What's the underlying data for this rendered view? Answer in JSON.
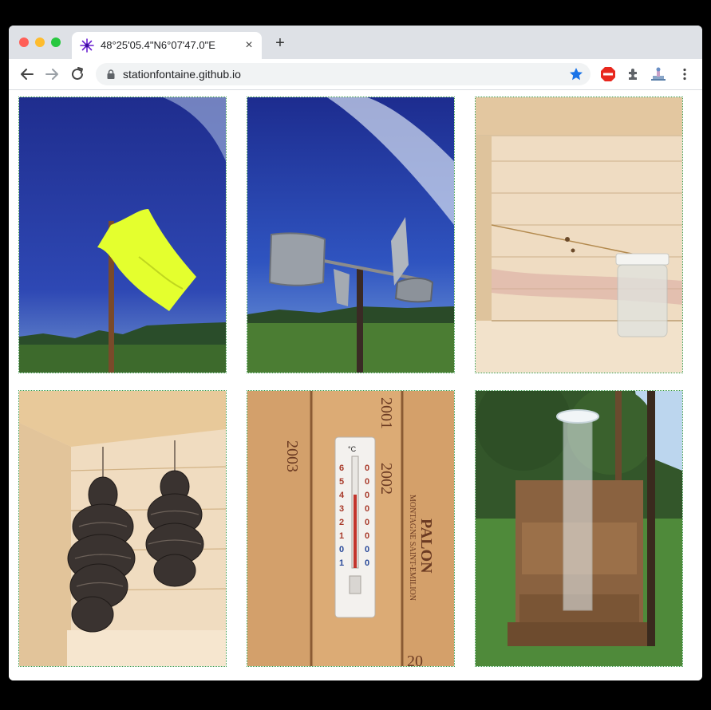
{
  "browser": {
    "tab_title": "48°25'05.4\"N6°07'47.0\"E",
    "url": "stationfontaine.github.io",
    "new_tab_label": "+",
    "close_label": "×"
  },
  "gallery": [
    {
      "subject": "yellow-flag-on-pole"
    },
    {
      "subject": "wind-vane"
    },
    {
      "subject": "jar-in-wooden-box"
    },
    {
      "subject": "pine-cones-hanging"
    },
    {
      "subject": "thermometer-on-wine-crate"
    },
    {
      "subject": "rain-gauge-in-wooden-stand"
    }
  ],
  "crate_text": {
    "year_left": "2003",
    "year_top": "2001",
    "year_mid": "2002",
    "brand": "PALON",
    "appellation": "MONTAGNE SAINT-EMILION",
    "year_bottom": "20"
  },
  "thermometer": {
    "unit": "°C",
    "left_scale": [
      "6",
      "5",
      "4",
      "3",
      "2",
      "1",
      "0",
      "1"
    ],
    "right_scale": [
      "0",
      "0",
      "0",
      "0",
      "0",
      "0",
      "0",
      "0"
    ]
  },
  "colors": {
    "sky": "#26399b",
    "flag": "#e4ff2e",
    "grass": "#3f6a2d",
    "wood": "#e9cfa9",
    "star": "#1a73e8"
  }
}
